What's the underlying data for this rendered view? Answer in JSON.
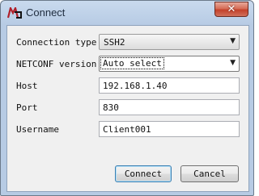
{
  "window": {
    "title": "Connect",
    "close_glyph": "✕",
    "app_icon": "app-logo-icon"
  },
  "form": {
    "connection_type": {
      "label": "Connection type",
      "value": "SSH2"
    },
    "netconf_version": {
      "label": "NETCONF version",
      "value": "Auto select"
    },
    "host": {
      "label": "Host",
      "value": "192.168.1.40"
    },
    "port": {
      "label": "Port",
      "value": "830"
    },
    "username": {
      "label": "Username",
      "value": "Client001"
    }
  },
  "buttons": {
    "connect": "Connect",
    "cancel": "Cancel"
  },
  "colors": {
    "close_button": "#c3412a",
    "default_button_border": "#3c7fb1"
  }
}
